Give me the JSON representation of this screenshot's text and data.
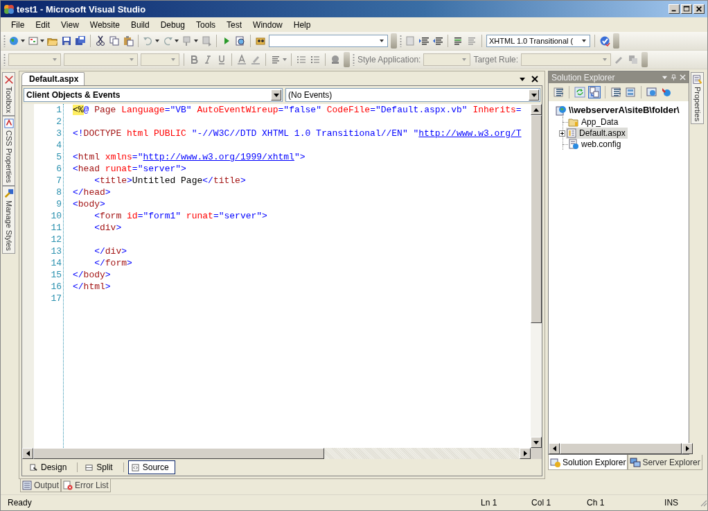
{
  "window": {
    "title": "test1 - Microsoft Visual Studio"
  },
  "menu": [
    "File",
    "Edit",
    "View",
    "Website",
    "Build",
    "Debug",
    "Tools",
    "Test",
    "Window",
    "Help"
  ],
  "toolbar_1": {
    "target_schema": "XHTML 1.0 Transitional ("
  },
  "toolbar_2": {
    "style_application_label": "Style Application:",
    "target_rule_label": "Target Rule:"
  },
  "left_side_tabs": [
    {
      "label": "Toolbox",
      "kind": "toolbox"
    },
    {
      "label": "CSS Properties",
      "kind": "css"
    },
    {
      "label": "Manage Styles",
      "kind": "styles"
    }
  ],
  "document_tabs": [
    {
      "label": "Default.aspx",
      "selected": true
    }
  ],
  "object_dropdown": {
    "value": "Client Objects & Events"
  },
  "event_dropdown": {
    "value": "(No Events)"
  },
  "code_lines": [
    {
      "number": "1",
      "tokens": [
        {
          "kind": "delim",
          "text": "<%"
        },
        {
          "kind": "punct",
          "text": "@ "
        },
        {
          "kind": "tag",
          "text": "Page"
        },
        {
          "kind": "attr",
          "text": " Language"
        },
        {
          "kind": "punct",
          "text": "="
        },
        {
          "kind": "value",
          "text": "\"VB\""
        },
        {
          "kind": "attr",
          "text": " AutoEventWireup"
        },
        {
          "kind": "punct",
          "text": "="
        },
        {
          "kind": "value",
          "text": "\"false\""
        },
        {
          "kind": "attr",
          "text": " CodeFile"
        },
        {
          "kind": "punct",
          "text": "="
        },
        {
          "kind": "value",
          "text": "\"Default.aspx.vb\""
        },
        {
          "kind": "attr",
          "text": " Inherits"
        },
        {
          "kind": "punct",
          "text": "="
        }
      ]
    },
    {
      "number": "2"
    },
    {
      "number": "3",
      "tokens": [
        {
          "kind": "punct",
          "text": "<!"
        },
        {
          "kind": "tag",
          "text": "DOCTYPE"
        },
        {
          "kind": "attr",
          "text": " html"
        },
        {
          "kind": "attr",
          "text": " PUBLIC"
        },
        {
          "kind": "value",
          "text": " \"-//W3C//DTD XHTML 1.0 Transitional//EN\" \""
        },
        {
          "kind": "link",
          "text": "http://www.w3.org/T"
        }
      ]
    },
    {
      "number": "4"
    },
    {
      "number": "5",
      "tokens": [
        {
          "kind": "punct",
          "text": "<"
        },
        {
          "kind": "tag",
          "text": "html"
        },
        {
          "kind": "attr",
          "text": " xmlns"
        },
        {
          "kind": "punct",
          "text": "="
        },
        {
          "kind": "value",
          "text": "\""
        },
        {
          "kind": "link",
          "text": "http://www.w3.org/1999/xhtml"
        },
        {
          "kind": "value",
          "text": "\""
        },
        {
          "kind": "punct",
          "text": ">"
        }
      ]
    },
    {
      "number": "6",
      "tokens": [
        {
          "kind": "punct",
          "text": "<"
        },
        {
          "kind": "tag",
          "text": "head"
        },
        {
          "kind": "attr",
          "text": " runat"
        },
        {
          "kind": "punct",
          "text": "="
        },
        {
          "kind": "value",
          "text": "\"server\""
        },
        {
          "kind": "punct",
          "text": ">"
        }
      ]
    },
    {
      "number": "7",
      "tokens": [
        {
          "kind": "punct",
          "text": "    <"
        },
        {
          "kind": "tag",
          "text": "title"
        },
        {
          "kind": "punct",
          "text": ">"
        },
        {
          "kind": "text",
          "text": "Untitled Page"
        },
        {
          "kind": "punct",
          "text": "</"
        },
        {
          "kind": "tag",
          "text": "title"
        },
        {
          "kind": "punct",
          "text": ">"
        }
      ]
    },
    {
      "number": "8",
      "tokens": [
        {
          "kind": "punct",
          "text": "</"
        },
        {
          "kind": "tag",
          "text": "head"
        },
        {
          "kind": "punct",
          "text": ">"
        }
      ]
    },
    {
      "number": "9",
      "tokens": [
        {
          "kind": "punct",
          "text": "<"
        },
        {
          "kind": "tag",
          "text": "body"
        },
        {
          "kind": "punct",
          "text": ">"
        }
      ]
    },
    {
      "number": "10",
      "tokens": [
        {
          "kind": "punct",
          "text": "    <"
        },
        {
          "kind": "tag",
          "text": "form"
        },
        {
          "kind": "attr",
          "text": " id"
        },
        {
          "kind": "punct",
          "text": "="
        },
        {
          "kind": "value",
          "text": "\"form1\""
        },
        {
          "kind": "attr",
          "text": " runat"
        },
        {
          "kind": "punct",
          "text": "="
        },
        {
          "kind": "value",
          "text": "\"server\""
        },
        {
          "kind": "punct",
          "text": ">"
        }
      ]
    },
    {
      "number": "11",
      "tokens": [
        {
          "kind": "punct",
          "text": "    <"
        },
        {
          "kind": "tag",
          "text": "div"
        },
        {
          "kind": "punct",
          "text": ">"
        }
      ]
    },
    {
      "number": "12"
    },
    {
      "number": "13",
      "tokens": [
        {
          "kind": "punct",
          "text": "    </"
        },
        {
          "kind": "tag",
          "text": "div"
        },
        {
          "kind": "punct",
          "text": ">"
        }
      ]
    },
    {
      "number": "14",
      "tokens": [
        {
          "kind": "punct",
          "text": "    </"
        },
        {
          "kind": "tag",
          "text": "form"
        },
        {
          "kind": "punct",
          "text": ">"
        }
      ]
    },
    {
      "number": "15",
      "tokens": [
        {
          "kind": "punct",
          "text": "</"
        },
        {
          "kind": "tag",
          "text": "body"
        },
        {
          "kind": "punct",
          "text": ">"
        }
      ]
    },
    {
      "number": "16",
      "tokens": [
        {
          "kind": "punct",
          "text": "</"
        },
        {
          "kind": "tag",
          "text": "html"
        },
        {
          "kind": "punct",
          "text": ">"
        }
      ]
    },
    {
      "number": "17"
    }
  ],
  "view_tabs": [
    {
      "label": "Design",
      "kind": "design",
      "selected": false
    },
    {
      "label": "Split",
      "kind": "split",
      "selected": false
    },
    {
      "label": "Source",
      "kind": "source",
      "selected": true
    }
  ],
  "bottom_tabs": [
    {
      "label": "Output",
      "kind": "output",
      "selected": false
    },
    {
      "label": "Error List",
      "kind": "errors",
      "selected": false
    }
  ],
  "solution_explorer": {
    "title": "Solution Explorer",
    "tree": [
      {
        "label": "\\\\webserverA\\siteB\\folder\\",
        "kind": "site",
        "selected": false,
        "children": [
          {
            "label": "App_Data",
            "kind": "folder",
            "selected": false
          },
          {
            "label": "Default.aspx",
            "kind": "page",
            "selected": true,
            "expanded": false
          },
          {
            "label": "web.config",
            "kind": "config",
            "selected": false
          }
        ]
      }
    ]
  },
  "explorer_tabs": [
    {
      "label": "Solution Explorer",
      "kind": "solution",
      "selected": true
    },
    {
      "label": "Server Explorer",
      "kind": "server",
      "selected": false
    }
  ],
  "right_side_tabs": [
    {
      "label": "Properties"
    }
  ],
  "status_bar": {
    "message": "Ready",
    "line": "Ln 1",
    "column": "Col 1",
    "character": "Ch 1",
    "mode": "INS"
  }
}
